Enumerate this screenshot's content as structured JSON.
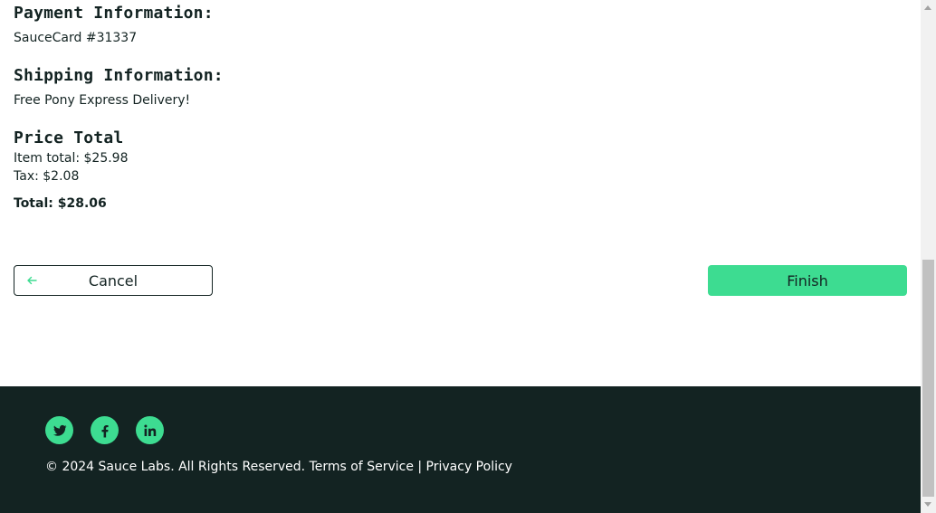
{
  "summary": {
    "payment_label": "Payment Information:",
    "payment_value": "SauceCard #31337",
    "shipping_label": "Shipping Information:",
    "shipping_value": "Free Pony Express Delivery!",
    "price_label": "Price Total",
    "item_total": "Item total: $25.98",
    "tax": "Tax: $2.08",
    "total": "Total: $28.06"
  },
  "actions": {
    "cancel_label": "Cancel",
    "cancel_icon": "arrow-left-icon",
    "finish_label": "Finish"
  },
  "footer": {
    "social_icons": [
      "twitter-icon",
      "facebook-icon",
      "linkedin-icon"
    ],
    "copyright": "© 2024 Sauce Labs. All Rights Reserved. Terms of Service | Privacy Policy"
  },
  "colors": {
    "accent": "#3ddc91",
    "footer_bg": "#132322",
    "text": "#132322"
  }
}
